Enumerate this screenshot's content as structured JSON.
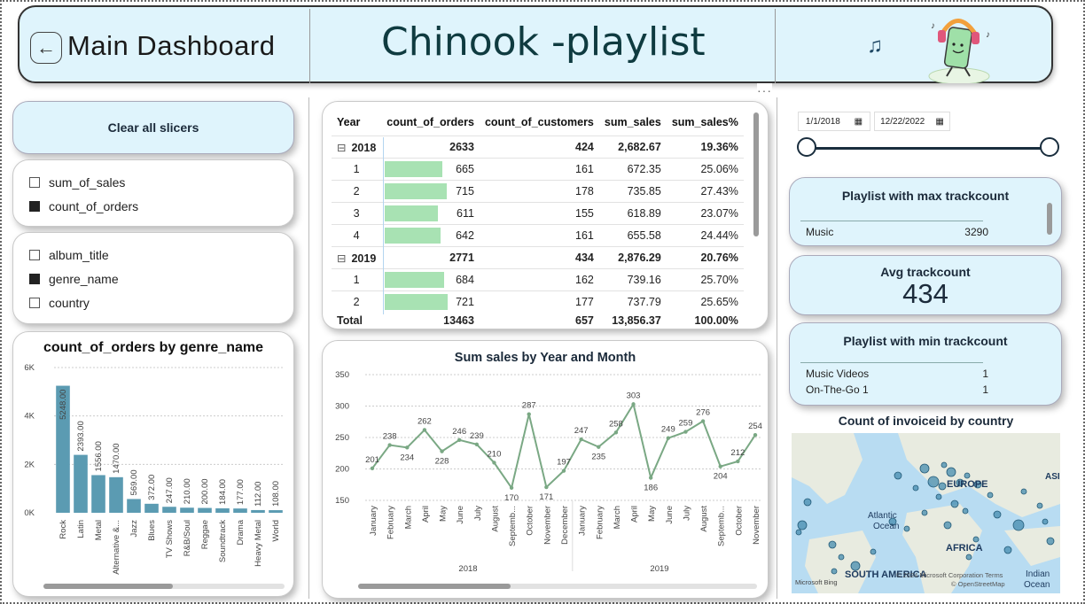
{
  "header": {
    "back_icon": "back-arrow-icon",
    "main_title": "Main Dashboard",
    "playlist_title": "Chinook -playlist",
    "music_note": "♫",
    "more_options": "···"
  },
  "slicers": {
    "clear_label": "Clear all slicers",
    "measures": [
      {
        "label": "sum_of_sales",
        "checked": false
      },
      {
        "label": "count_of_orders",
        "checked": true
      }
    ],
    "dimensions": [
      {
        "label": "album_title",
        "checked": false
      },
      {
        "label": "genre_name",
        "checked": true
      },
      {
        "label": "country",
        "checked": false
      }
    ]
  },
  "date_filter": {
    "start": "1/1/2018",
    "end": "12/22/2022",
    "calendar_icon": "calendar-icon"
  },
  "matrix": {
    "headers": [
      "Year",
      "count_of_orders",
      "count_of_customers",
      "sum_sales",
      "sum_sales%"
    ],
    "collapse_glyph": "⊟",
    "max_orders": 800,
    "rows": [
      {
        "type": "group",
        "label": "2018",
        "orders": "2633",
        "customers": "424",
        "sales": "2,682.67",
        "pct": "19.36%"
      },
      {
        "type": "row",
        "label": "1",
        "orders": "665",
        "orders_val": 665,
        "customers": "161",
        "sales": "672.35",
        "pct": "25.06%"
      },
      {
        "type": "row",
        "label": "2",
        "orders": "715",
        "orders_val": 715,
        "customers": "178",
        "sales": "735.85",
        "pct": "27.43%"
      },
      {
        "type": "row",
        "label": "3",
        "orders": "611",
        "orders_val": 611,
        "customers": "155",
        "sales": "618.89",
        "pct": "23.07%"
      },
      {
        "type": "row",
        "label": "4",
        "orders": "642",
        "orders_val": 642,
        "customers": "161",
        "sales": "655.58",
        "pct": "24.44%"
      },
      {
        "type": "group",
        "label": "2019",
        "orders": "2771",
        "customers": "434",
        "sales": "2,876.29",
        "pct": "20.76%"
      },
      {
        "type": "row",
        "label": "1",
        "orders": "684",
        "orders_val": 684,
        "customers": "162",
        "sales": "739.16",
        "pct": "25.70%"
      },
      {
        "type": "row",
        "label": "2",
        "orders": "721",
        "orders_val": 721,
        "customers": "177",
        "sales": "737.79",
        "pct": "25.65%"
      }
    ],
    "total": {
      "label": "Total",
      "orders": "13463",
      "customers": "657",
      "sales": "13,856.37",
      "pct": "100.00%"
    }
  },
  "kpis": {
    "max_title": "Playlist with max trackcount",
    "max_rows": [
      {
        "name": "Music",
        "value": "3290"
      }
    ],
    "avg_title": "Avg trackcount",
    "avg_value": "434",
    "min_title": "Playlist with min trackcount",
    "min_rows": [
      {
        "name": "Music Videos",
        "value": "1"
      },
      {
        "name": "On-The-Go 1",
        "value": "1"
      }
    ]
  },
  "map": {
    "title": "Count of invoiceid by country",
    "labels": [
      "EUROPE",
      "Atlantic",
      "Ocean",
      "AFRICA",
      "SOUTH AMERICA",
      "ASIA",
      "Indian",
      "Ocean"
    ],
    "attribution": "© 2024 Microsoft Corporation  Terms",
    "attribution2": "© OpenStreetMap",
    "brand": "Microsoft Bing"
  },
  "chart_data": [
    {
      "type": "bar",
      "title": "count_of_orders by genre_name",
      "categories": [
        "Rock",
        "Latin",
        "Metal",
        "Alternative &...",
        "Jazz",
        "Blues",
        "TV Shows",
        "R&B/Soul",
        "Reggae",
        "Soundtrack",
        "Drama",
        "Heavy Metal",
        "World"
      ],
      "values": [
        5248,
        2393,
        1556,
        1470,
        569,
        372,
        247,
        210,
        200,
        184,
        177,
        112,
        108
      ],
      "data_labels": [
        "5248.00",
        "2393.00",
        "1556.00",
        "1470.00",
        "569.00",
        "372.00",
        "247.00",
        "210.00",
        "200.00",
        "184.00",
        "177.00",
        "112.00",
        "108.00"
      ],
      "yticks": [
        "0K",
        "2K",
        "4K",
        "6K"
      ],
      "ylim": [
        0,
        6000
      ],
      "color": "#5b9bb2"
    },
    {
      "type": "line",
      "title": "Sum sales by Year and Month",
      "years": [
        "2018",
        "2019"
      ],
      "months": [
        "January",
        "February",
        "March",
        "April",
        "May",
        "June",
        "July",
        "August",
        "Septemb...",
        "October",
        "November",
        "December",
        "January",
        "February",
        "March",
        "April",
        "May",
        "June",
        "July",
        "August",
        "Septemb...",
        "October",
        "November"
      ],
      "values": [
        201,
        238,
        234,
        262,
        228,
        246,
        239,
        210,
        170,
        287,
        171,
        197,
        247,
        235,
        258,
        303,
        186,
        249,
        259,
        276,
        204,
        212,
        254
      ],
      "yticks": [
        "150",
        "200",
        "250",
        "300",
        "350"
      ],
      "ylim": [
        150,
        350
      ],
      "color": "#7aa884"
    }
  ]
}
